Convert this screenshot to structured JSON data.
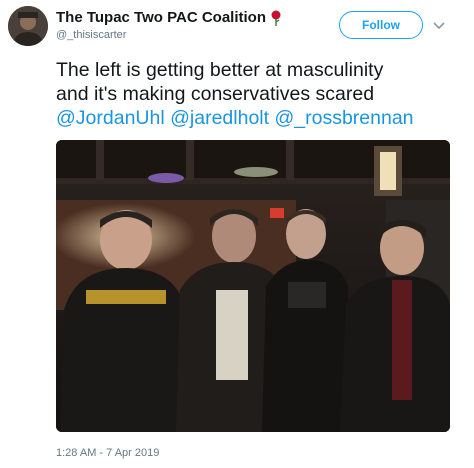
{
  "tweet": {
    "display_name": "The Tupac Two PAC Coalition",
    "handle": "@_thisiscarter",
    "follow_label": "Follow",
    "text_line1": "The left is getting better at masculinity",
    "text_line2": "and it's making conservatives scared",
    "mentions": [
      "@JordanUhl",
      "@jaredlholt",
      "@_rossbrennan"
    ],
    "timestamp": "1:28 AM - 7 Apr 2019"
  },
  "icons": {
    "name_emoji": "rose-icon",
    "menu": "chevron-down-icon"
  },
  "colors": {
    "accent": "#1da1f2",
    "mention": "#1b95e0",
    "muted": "#657786",
    "text": "#14171a"
  }
}
